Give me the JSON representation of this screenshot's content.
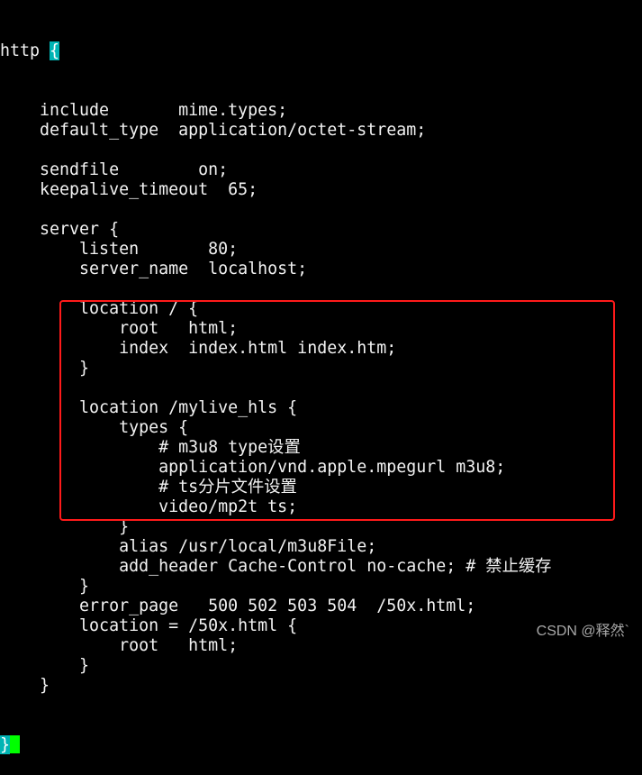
{
  "terminal": {
    "first_line_prefix": "http ",
    "first_line_brace": "{",
    "lines": [
      "    include       mime.types;",
      "    default_type  application/octet-stream;",
      "",
      "    sendfile        on;",
      "    keepalive_timeout  65;",
      "",
      "    server {",
      "        listen       80;",
      "        server_name  localhost;",
      "",
      "        location / {",
      "            root   html;",
      "            index  index.html index.htm;",
      "        }",
      "",
      "        location /mylive_hls {",
      "            types {",
      "                # m3u8 type设置",
      "                application/vnd.apple.mpegurl m3u8;",
      "                # ts分片文件设置",
      "                video/mp2t ts;",
      "            }",
      "            alias /usr/local/m3u8File;",
      "            add_header Cache-Control no-cache; # 禁止缓存",
      "        }",
      "        error_page   500 502 503 504  /50x.html;",
      "        location = /50x.html {",
      "            root   html;",
      "        }",
      "    }"
    ],
    "last_line_brace": "}",
    "colors": {
      "background": "#000000",
      "text": "#f2f2f2",
      "highlight": "#00b4b4",
      "cursor": "#00ff00",
      "annotation_box": "#ff1a1a"
    }
  },
  "watermark": "CSDN @释然`"
}
